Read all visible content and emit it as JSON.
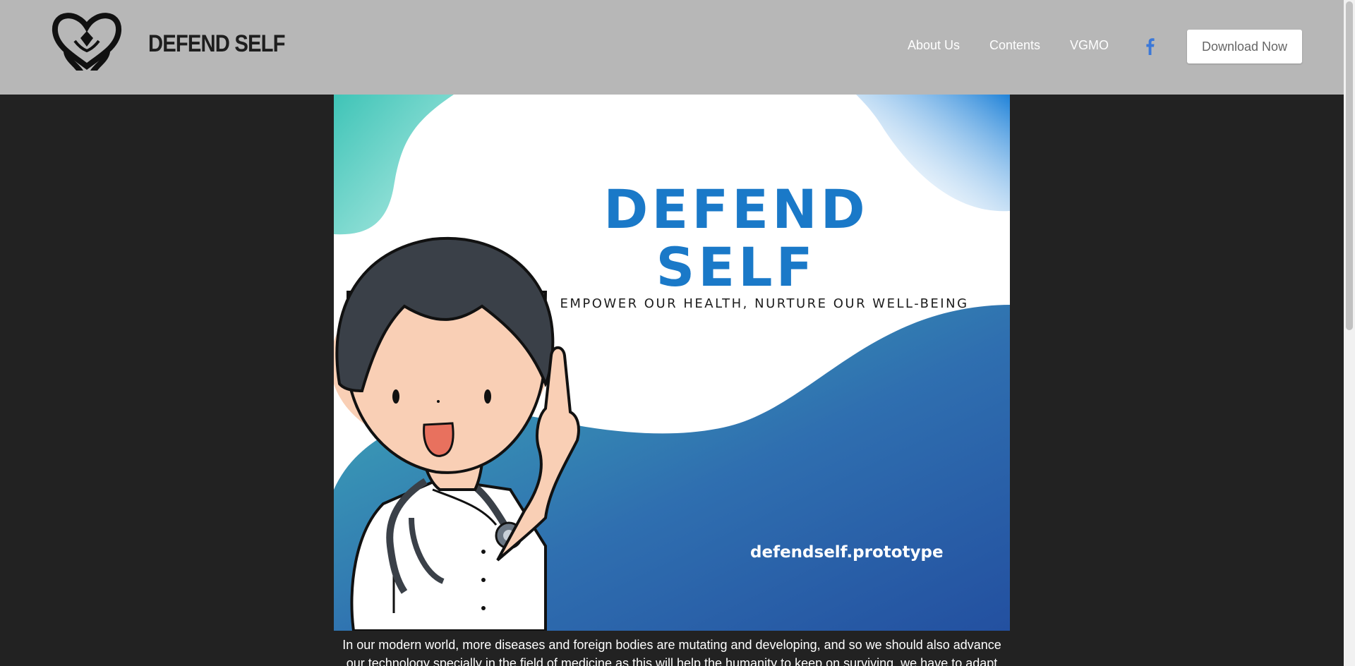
{
  "header": {
    "brand": "DEFEND SELF",
    "nav": [
      {
        "label": "About Us"
      },
      {
        "label": "Contents"
      },
      {
        "label": "VGMO"
      }
    ],
    "social_icon": "facebook-icon",
    "download_label": "Download Now"
  },
  "hero": {
    "title_line1": "DEFEND",
    "title_line2": "SELF",
    "subtitle": "EMPOWER OUR HEALTH, NURTURE OUR WELL-BEING",
    "url": "defendself.prototype"
  },
  "intro": {
    "text": "In our modern world, more diseases and foreign bodies are mutating and developing, and so we should also advance our technology specially in the field of medicine as this will help the humanity to keep on surviving, we have to adapt with our"
  },
  "colors": {
    "header_bg": "#b7b7b7",
    "page_bg": "#222222",
    "hero_blue": "#1a79c8",
    "facebook": "#3b78d8"
  }
}
